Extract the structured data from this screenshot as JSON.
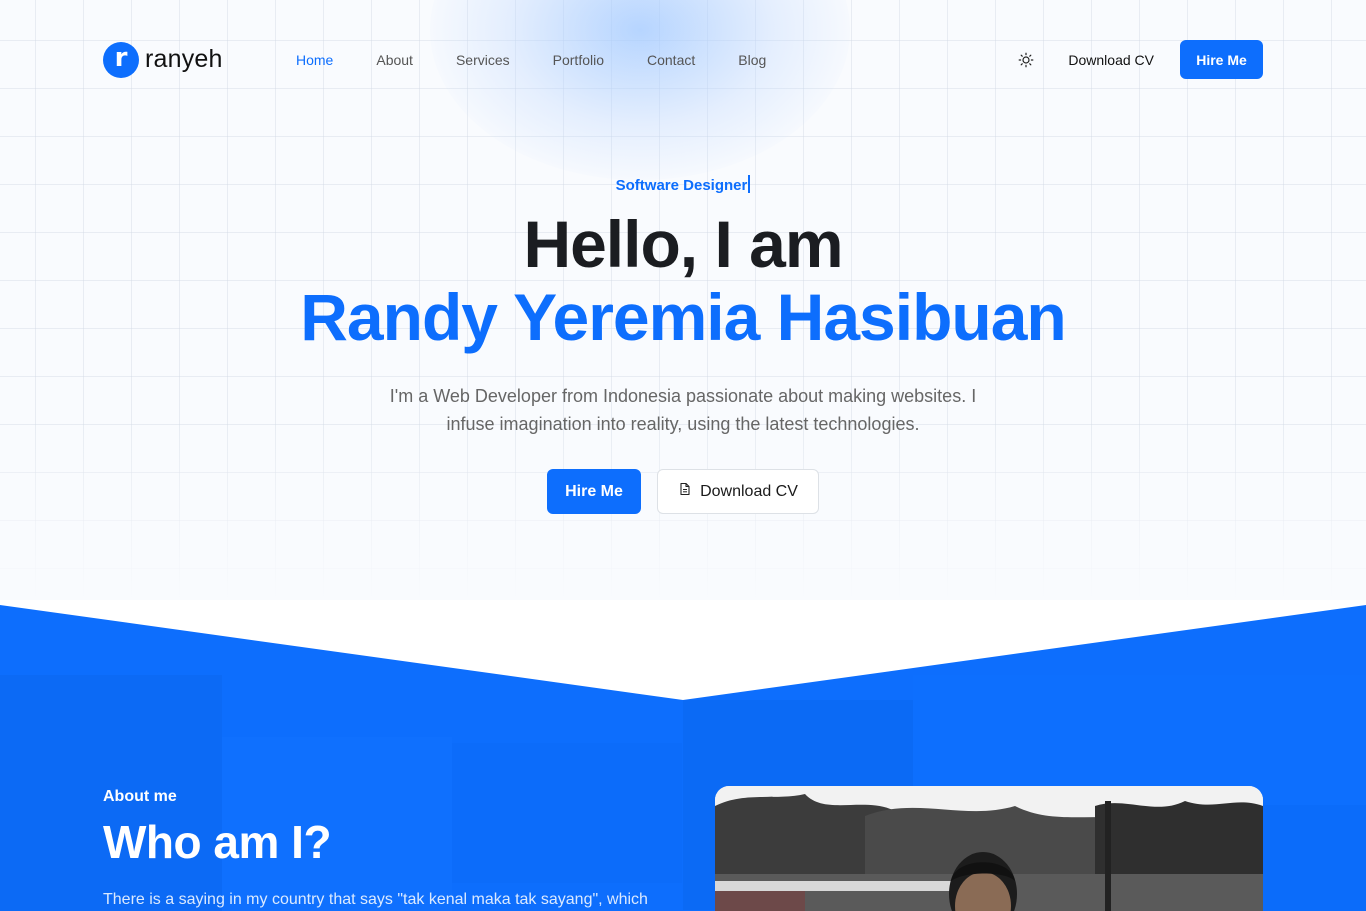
{
  "header": {
    "logo_letter": "r",
    "logo_text": "ranyeh",
    "nav": [
      {
        "label": "Home",
        "active": true
      },
      {
        "label": "About",
        "active": false
      },
      {
        "label": "Services",
        "active": false
      },
      {
        "label": "Portfolio",
        "active": false
      },
      {
        "label": "Contact",
        "active": false
      },
      {
        "label": "Blog",
        "active": false
      }
    ],
    "theme_toggle_icon": "sun-icon",
    "download_cv_label": "Download CV",
    "hire_me_label": "Hire Me"
  },
  "hero": {
    "role": "Software Designer",
    "greeting": "Hello, I am",
    "name": "Randy Yeremia Hasibuan",
    "description": "I'm a Web Developer from Indonesia passionate about making websites. I infuse imagination into reality, using the latest technologies.",
    "hire_me_label": "Hire Me",
    "download_cv_label": "Download CV",
    "download_cv_icon": "document-icon"
  },
  "about": {
    "label": "About me",
    "title": "Who am I?",
    "text": "There is a saying in my country that says \"tak kenal maka tak sayang\", which",
    "photo_alt": "portrait-photo"
  },
  "colors": {
    "accent": "#0d6efd",
    "text_dark": "#1b1d21",
    "text_muted": "#666666"
  }
}
